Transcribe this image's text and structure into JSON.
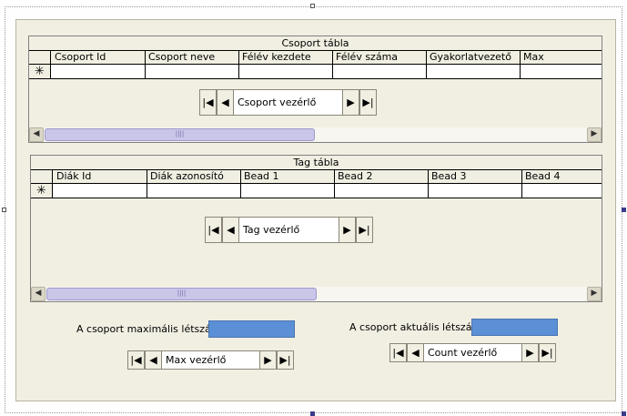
{
  "group_grid": {
    "caption": "Csoport tábla",
    "columns": [
      "Csoport Id",
      "Csoport neve",
      "Félév kezdete",
      "Félév száma",
      "Gyakorlatvezető",
      "Max"
    ],
    "new_row_marker": "✳"
  },
  "group_navigator": {
    "label": "Csoport vezérlő"
  },
  "member_grid": {
    "caption": "Tag tábla",
    "columns": [
      "Diák Id",
      "Diák azonosító",
      "Bead 1",
      "Bead 2",
      "Bead 3",
      "Bead 4"
    ],
    "new_row_marker": "✳"
  },
  "member_navigator": {
    "label": "Tag vezérlő"
  },
  "max_field": {
    "label": "A csoport maximális létszáma:"
  },
  "max_navigator": {
    "label": "Max vezérlő"
  },
  "count_field": {
    "label": "A csoport aktuális létszáma:"
  },
  "count_navigator": {
    "label": "Count vezérlő"
  },
  "icons": {
    "first": "first-record-icon",
    "prev": "prev-record-icon",
    "next": "next-record-icon",
    "last": "last-record-icon"
  },
  "colors": {
    "form_background": "#f1efe2",
    "value_box": "#5b8fd6",
    "scroll_thumb": "#c9c6e8"
  }
}
